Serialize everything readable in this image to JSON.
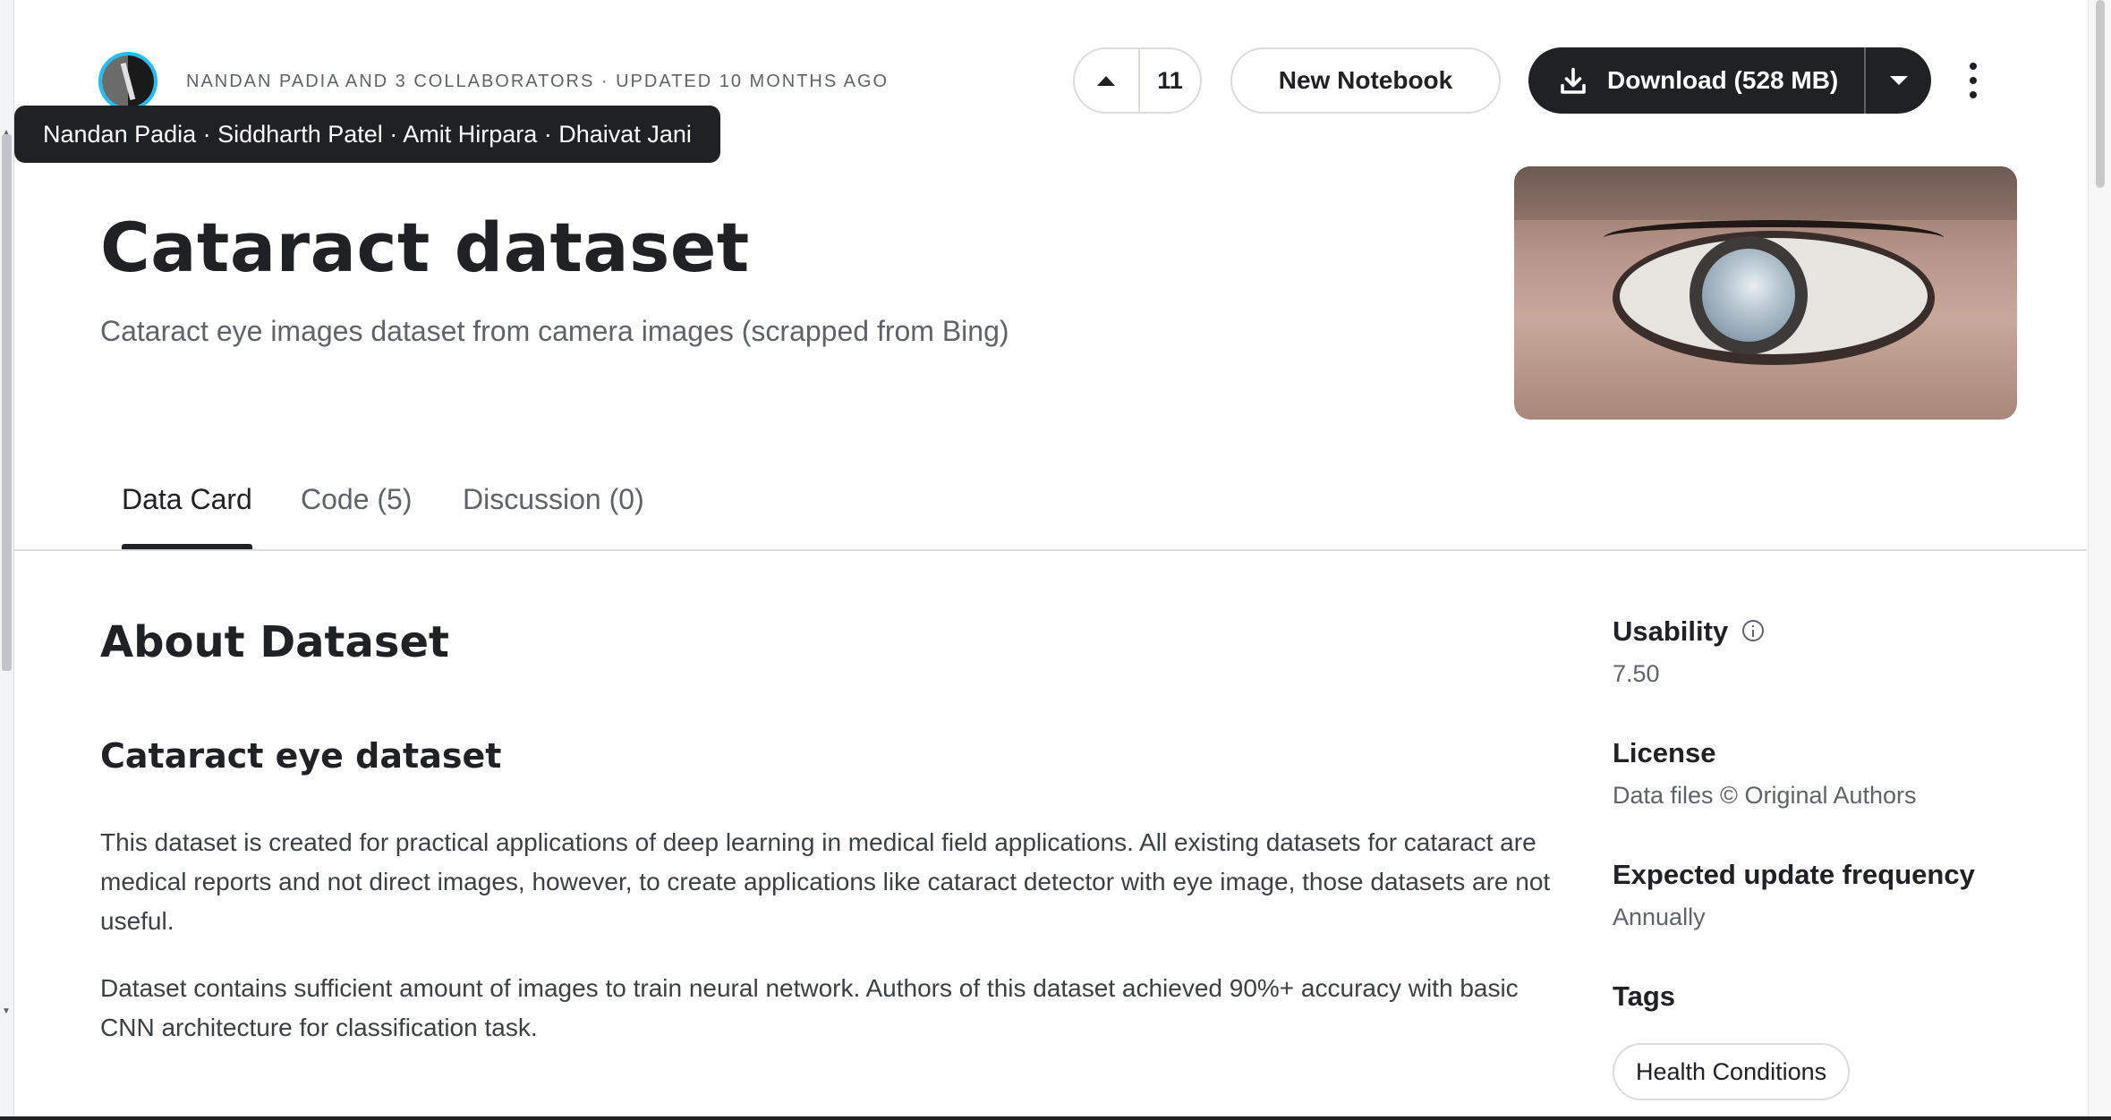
{
  "header": {
    "byline": "Nandan Padia and 3 collaborators · Updated 10 months ago",
    "tooltip": "Nandan Padia · Siddharth Patel · Amit Hirpara · Dhaivat Jani",
    "upvote_count": "11",
    "new_notebook_label": "New Notebook",
    "download_label": "Download (528 MB)"
  },
  "dataset": {
    "title": "Cataract dataset",
    "subtitle": "Cataract eye images dataset from camera images (scrapped from Bing)"
  },
  "tabs": [
    {
      "label": "Data Card",
      "active": true
    },
    {
      "label": "Code (5)",
      "active": false
    },
    {
      "label": "Discussion (0)",
      "active": false
    }
  ],
  "about": {
    "heading": "About Dataset",
    "section_heading": "Cataract eye dataset",
    "paragraphs": [
      "This dataset is created for practical applications of deep learning in medical field applications. All existing datasets for cataract are medical reports and not direct images, however, to create applications like cataract detector with eye image, those datasets are not useful.",
      "Dataset contains sufficient amount of images to train neural network. Authors of this dataset achieved 90%+ accuracy with basic CNN architecture for classification task."
    ]
  },
  "sidebar": {
    "usability": {
      "label": "Usability",
      "value": "7.50"
    },
    "license": {
      "label": "License",
      "value": "Data files © Original Authors"
    },
    "frequency": {
      "label": "Expected update frequency",
      "value": "Annually"
    },
    "tags": {
      "label": "Tags",
      "items": [
        "Health Conditions"
      ]
    }
  },
  "icons": [
    "avatar",
    "upvote-arrow-icon",
    "download-icon",
    "caret-down-icon",
    "more-vert-icon",
    "info-icon"
  ],
  "colors": {
    "primary_dark": "#202124",
    "muted_text": "#5f6368",
    "border": "#dadce0",
    "accent_blue": "#20beff"
  }
}
